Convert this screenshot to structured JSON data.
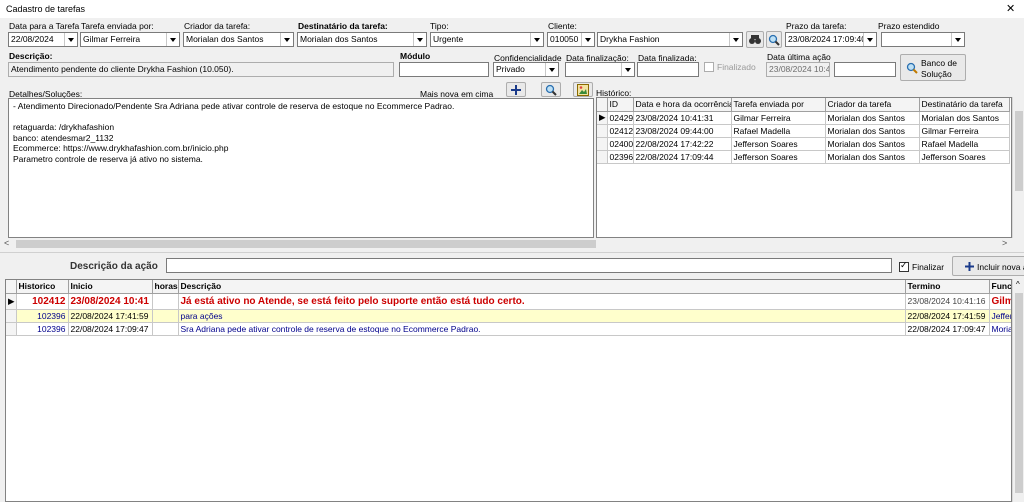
{
  "window": {
    "title": "Cadastro de tarefas",
    "close": "✕"
  },
  "fields": {
    "data_tarefa": {
      "label": "Data para a Tarefa",
      "value": "22/08/2024"
    },
    "enviada_por": {
      "label": "Tarefa enviada por:",
      "value": "Gilmar Ferreira"
    },
    "criador": {
      "label": "Criador da tarefa:",
      "value": "Morialan dos Santos"
    },
    "destinatario": {
      "label": "Destinatário da tarefa:",
      "value": "Morialan dos Santos"
    },
    "tipo": {
      "label": "Tipo:",
      "value": "Urgente"
    },
    "cliente": {
      "label": "Cliente:",
      "code": "010050",
      "name": "Drykha Fashion"
    },
    "prazo": {
      "label": "Prazo da tarefa:",
      "value": "23/08/2024 17:09:40"
    },
    "prazo_estendido": {
      "label": "Prazo estendido",
      "value": ""
    },
    "descricao": {
      "label": "Descrição:",
      "value": "Atendimento pendente do cliente Drykha Fashion (10.050)."
    },
    "modulo": {
      "label": "Módulo",
      "value": ""
    },
    "confidencialidade": {
      "label": "Confidencialidade",
      "value": "Privado"
    },
    "data_finalizacao": {
      "label": "Data finalização:",
      "value": ""
    },
    "data_finalizada": {
      "label": "Data finalizada:",
      "value": ""
    },
    "finalizado": {
      "label": "Finalizado"
    },
    "data_ultima_acao": {
      "label": "Data última ação",
      "value": "23/08/2024 10:4",
      "value2": ""
    },
    "banco_solucao": {
      "line1": "Banco de",
      "line2": "Solução"
    }
  },
  "detalhes": {
    "label": "Detalhes/Soluções:",
    "mais_nova": "Mais nova em cima",
    "lines": [
      " - Atendimento Direcionado/Pendente Sra Adriana pede ativar controle de reserva de estoque no Ecommerce Padrao.",
      "",
      "retaguarda: /drykhafashion",
      "banco: atendesmar2_1132",
      "Ecommerce: https://www.drykhafashion.com.br/inicio.php",
      "Parametro controle de reserva já ativo no sistema."
    ]
  },
  "historico": {
    "label": "Histórico:",
    "columns": [
      "ID",
      "Data e hora da ocorrência",
      "Tarefa enviada por",
      "Criador da tarefa",
      "Destinatário da tarefa"
    ],
    "rows": [
      [
        "02429",
        "23/08/2024 10:41:31",
        "Gilmar Ferreira",
        "Morialan dos Santos",
        "Morialan dos Santos"
      ],
      [
        "02412",
        "23/08/2024 09:44:00",
        "Rafael Madella",
        "Morialan dos Santos",
        "Gilmar Ferreira"
      ],
      [
        "02400",
        "22/08/2024 17:42:22",
        "Jefferson Soares",
        "Morialan dos Santos",
        "Rafael Madella"
      ],
      [
        "02396",
        "22/08/2024 17:09:44",
        "Jefferson Soares",
        "Morialan dos Santos",
        "Jefferson Soares"
      ]
    ]
  },
  "acao": {
    "label": "Descrição da ação",
    "value": "",
    "finalizar": "Finalizar",
    "incluir": "Incluir nova a"
  },
  "acoes": {
    "columns": [
      "Historico",
      "Inicio",
      "horas",
      "Descrição",
      "Termino",
      "Func"
    ],
    "rows": [
      [
        "102412",
        "23/08/2024 10:41",
        "",
        "Já está ativo no Atende, se está feito pelo suporte então está tudo certo.",
        "23/08/2024 10:41:16",
        "Gilm"
      ],
      [
        "102396",
        "22/08/2024 17:41:59",
        "",
        "para ações",
        "22/08/2024 17:41:59",
        "Jeffers"
      ],
      [
        "102396",
        "22/08/2024 17:09:47",
        "",
        "Sra Adriana pede ativar controle de reserva de estoque no Ecommerce Padrao.",
        "22/08/2024 17:09:47",
        "Morial"
      ]
    ]
  },
  "colors": {
    "accent_red": "#cc0000",
    "highlight_row": "#ffffcc",
    "link_blue": "#00008b"
  }
}
